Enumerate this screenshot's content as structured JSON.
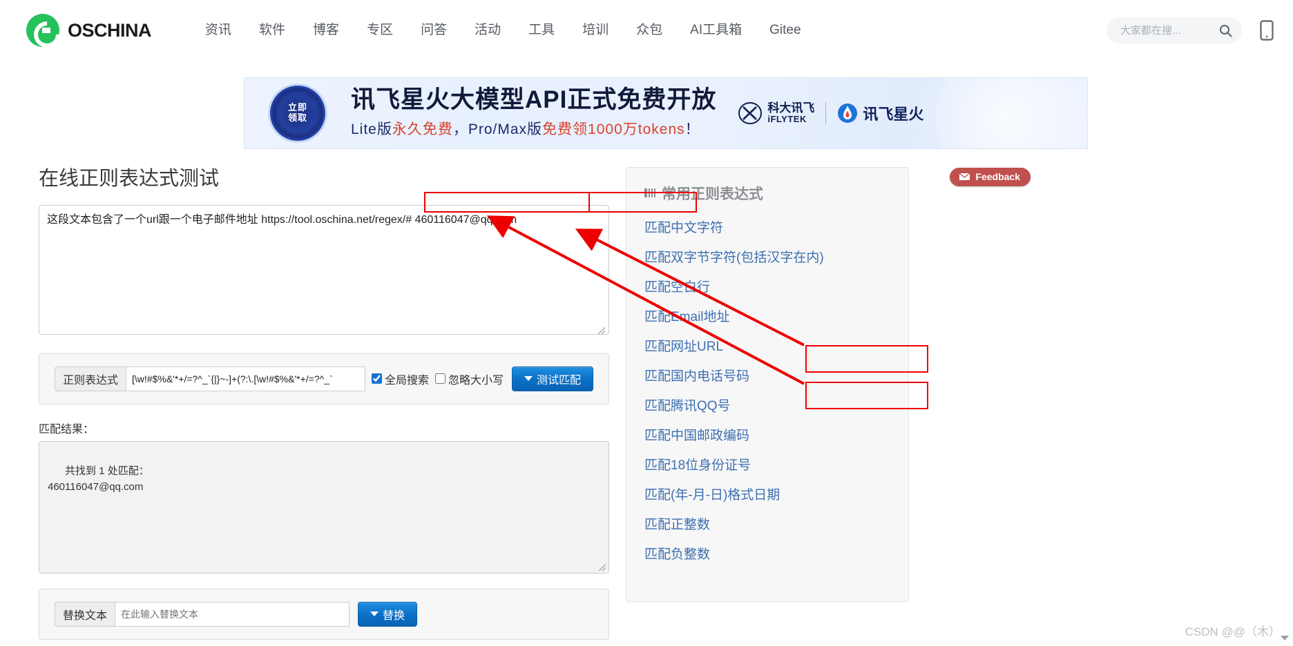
{
  "header": {
    "brand_name": "OSCHINA",
    "nav_items": [
      {
        "label": "资讯"
      },
      {
        "label": "软件"
      },
      {
        "label": "博客"
      },
      {
        "label": "专区"
      },
      {
        "label": "问答"
      },
      {
        "label": "活动"
      },
      {
        "label": "工具"
      },
      {
        "label": "培训"
      },
      {
        "label": "众包"
      },
      {
        "label": "AI工具箱"
      },
      {
        "label": "Gitee"
      }
    ],
    "search_placeholder": "大家都在搜...",
    "search_value": ""
  },
  "banner": {
    "seal_line1": "立即",
    "seal_line2": "领取",
    "title": "讯飞星火大模型API正式免费开放",
    "sub_prefix": "Lite版",
    "sub_hl1": "永久免费",
    "sub_mid": "，Pro/Max版",
    "sub_hl2": "免费领1000万tokens",
    "sub_suffix": "！",
    "logo_iflytek_cn": "科大讯飞",
    "logo_iflytek_en": "iFLYTEK",
    "logo_spark": "讯飞星火"
  },
  "main": {
    "page_title": "在线正则表达式测试",
    "feedback_label": "Feedback",
    "source_text": "这段文本包含了一个url跟一个电子邮件地址 https://tool.oschina.net/regex/# 460116047@qq.com",
    "regex_label": "正则表达式",
    "regex_value": "[\\w!#$%&'*+/=?^_`{|}~-]+(?:\\.[\\w!#$%&'*+/=?^_`",
    "global_search_label": "全局搜索",
    "global_search_checked": true,
    "ignore_case_label": "忽略大小写",
    "ignore_case_checked": false,
    "test_button_label": "测试匹配",
    "result_label": "匹配结果：",
    "result_text": "共找到 1 处匹配：\n460116047@qq.com",
    "replace_label": "替换文本",
    "replace_placeholder": "在此输入替换文本",
    "replace_value": "",
    "replace_button_label": "替换"
  },
  "sidebar": {
    "title": "常用正则表达式",
    "items": [
      {
        "label": "匹配中文字符"
      },
      {
        "label": "匹配双字节字符(包括汉字在内)"
      },
      {
        "label": "匹配空白行"
      },
      {
        "label": "匹配Email地址"
      },
      {
        "label": "匹配网址URL"
      },
      {
        "label": "匹配国内电话号码"
      },
      {
        "label": "匹配腾讯QQ号"
      },
      {
        "label": "匹配中国邮政编码"
      },
      {
        "label": "匹配18位身份证号"
      },
      {
        "label": "匹配(年-月-日)格式日期"
      },
      {
        "label": "匹配正整数"
      },
      {
        "label": "匹配负整数"
      }
    ]
  },
  "annotations": {
    "highlight_color": "#ee0000",
    "boxes": [
      {
        "name": "url-highlight"
      },
      {
        "name": "email-highlight"
      },
      {
        "name": "sidebar-email-highlight"
      },
      {
        "name": "sidebar-url-highlight"
      }
    ]
  },
  "watermark": {
    "text": "CSDN @@（木）"
  }
}
